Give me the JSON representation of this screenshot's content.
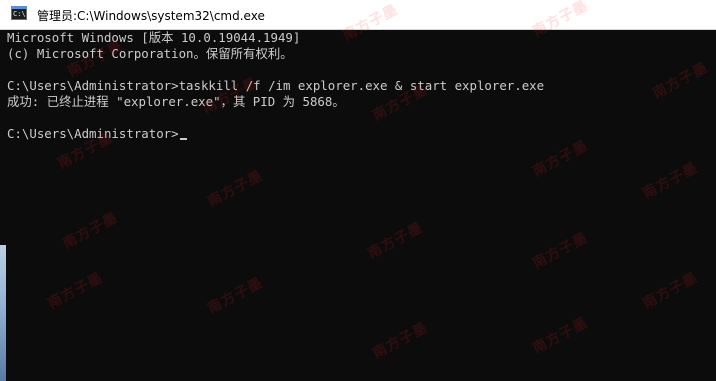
{
  "window": {
    "title_prefix": "管理员: ",
    "title_path": "C:\\Windows\\system32\\cmd.exe",
    "icon": "cmd-icon"
  },
  "console": {
    "lines": [
      "Microsoft Windows [版本 10.0.19044.1949]",
      "(c) Microsoft Corporation。保留所有权利。",
      "",
      "C:\\Users\\Administrator>taskkill /f /im explorer.exe & start explorer.exe",
      "成功: 已终止进程 \"explorer.exe\"，其 PID 为 5868。",
      "",
      "C:\\Users\\Administrator>"
    ]
  },
  "watermark": {
    "text": "南方子墨",
    "color": "#ff2323"
  },
  "colors": {
    "console_bg": "#0c0c0c",
    "console_text": "#cccccc",
    "titlebar_bg": "#ffffff"
  }
}
